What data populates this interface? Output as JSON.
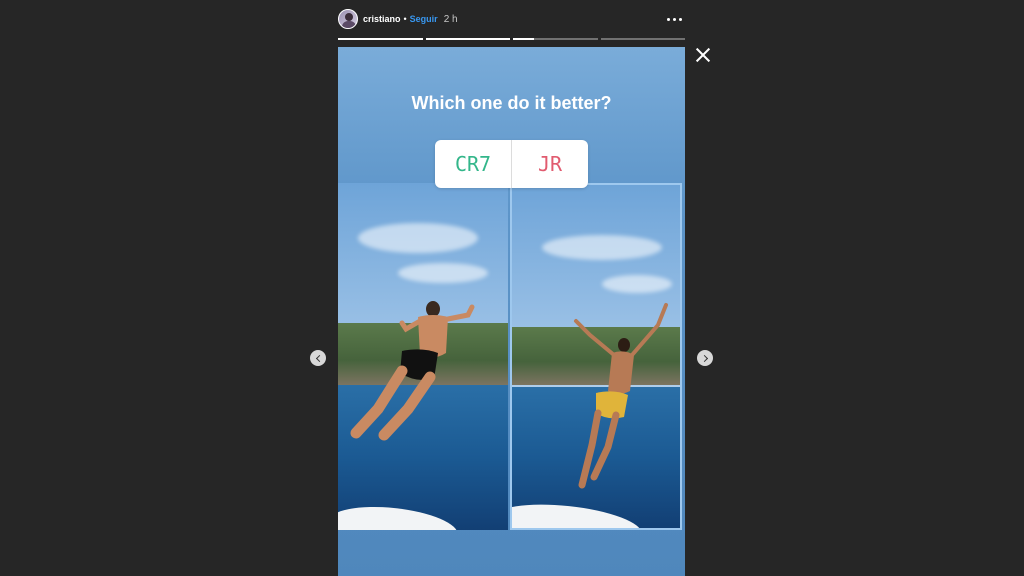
{
  "header": {
    "username": "cristiano",
    "separator": "•",
    "follow_label": "Seguir",
    "time": "2 h",
    "more_icon": "more-horizontal-icon"
  },
  "progress": {
    "segments": [
      1.0,
      1.0,
      0.25,
      0.0
    ]
  },
  "story": {
    "question": "Which one do it better?",
    "poll": {
      "option_left": "CR7",
      "option_right": "JR",
      "left_color": "#33b68a",
      "right_color": "#e15b6f"
    }
  },
  "controls": {
    "close_icon": "close-icon",
    "prev_icon": "chevron-left-icon",
    "next_icon": "chevron-right-icon"
  }
}
